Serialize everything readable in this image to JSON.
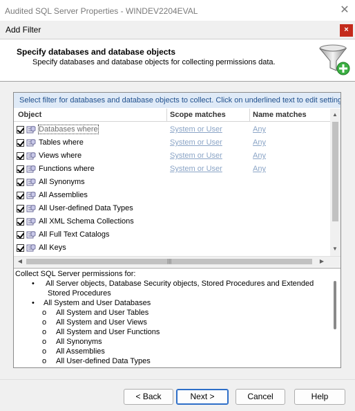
{
  "window": {
    "title": "Audited SQL Server Properties - WINDEV2204EVAL"
  },
  "dialog": {
    "title": "Add Filter",
    "banner_title": "Specify databases and database objects",
    "banner_subtitle": "Specify databases and database objects for collecting permissions data."
  },
  "filter": {
    "hint": "Select filter for databases and database objects to collect. Click on underlined text to edit settings.",
    "columns": {
      "object": "Object",
      "scope": "Scope matches",
      "name": "Name matches"
    },
    "rows": [
      {
        "label": "Databases where",
        "scope": "System or User",
        "name": "Any",
        "checked": true
      },
      {
        "label": "Tables where",
        "scope": "System or User",
        "name": "Any",
        "checked": true
      },
      {
        "label": "Views where",
        "scope": "System or User",
        "name": "Any",
        "checked": true
      },
      {
        "label": "Functions where",
        "scope": "System or User",
        "name": "Any",
        "checked": true
      },
      {
        "label": "All Synonyms",
        "checked": true
      },
      {
        "label": "All Assemblies",
        "checked": true
      },
      {
        "label": "All User-defined Data Types",
        "checked": true
      },
      {
        "label": "All XML Schema Collections",
        "checked": true
      },
      {
        "label": "All Full Text Catalogs",
        "checked": true
      },
      {
        "label": "All Keys",
        "checked": true
      }
    ]
  },
  "description": {
    "intro": "Collect SQL Server permissions for:",
    "bullet1_line1": "All Server objects, Database Security objects, Stored Procedures and Extended",
    "bullet1_line2": "Stored Procedures",
    "bullet2": "All System and User Databases",
    "sub_items": [
      "All System and User Tables",
      "All System and User Views",
      "All System and User Functions",
      "All Synonyms",
      "All Assemblies",
      "All User-defined Data Types"
    ],
    "bullet_glyph": "•",
    "sub_glyph": "o"
  },
  "buttons": {
    "back": "< Back",
    "next": "Next >",
    "cancel": "Cancel",
    "help": "Help"
  },
  "icons": {
    "close": "close-icon",
    "funnel": "funnel-add-icon",
    "database": "database-object-icon"
  },
  "colors": {
    "link": "#8aa4c6",
    "hint_bg": "#dfeaf7",
    "hint_text": "#1f4f8c",
    "close_bg": "#c42b1c"
  }
}
